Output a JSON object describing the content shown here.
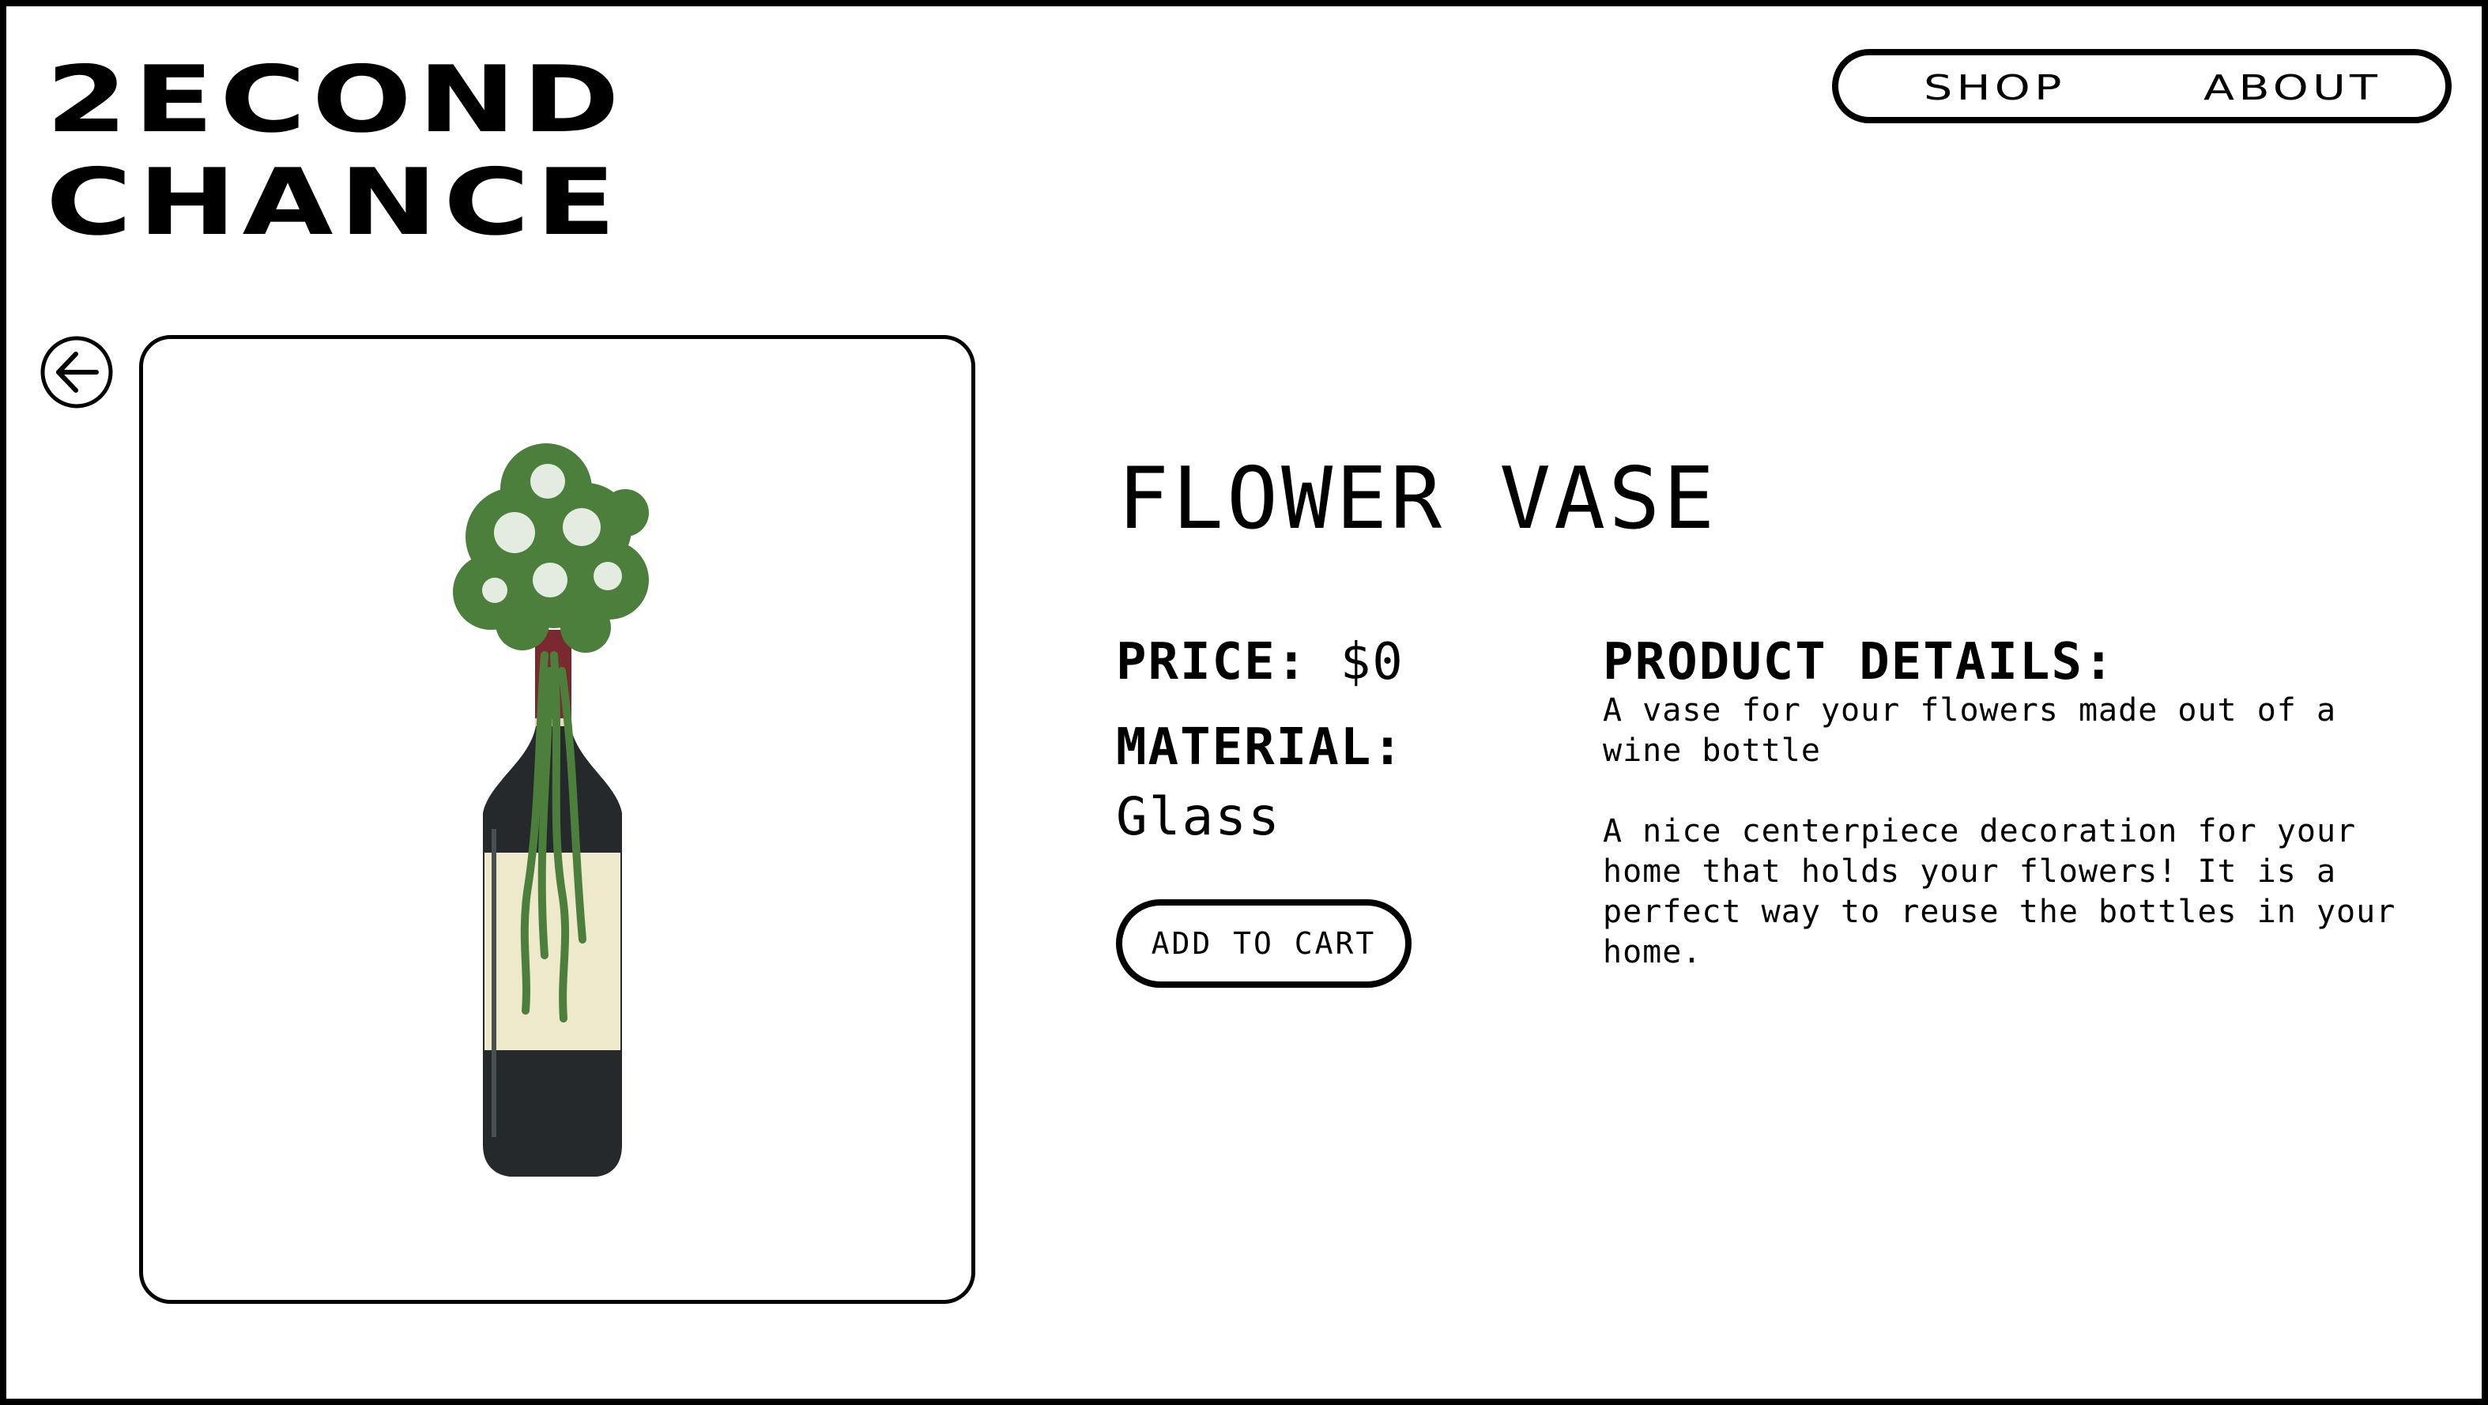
{
  "header": {
    "logo_line1": "2ECOND",
    "logo_line2": "CHANCE"
  },
  "nav": {
    "shop_label": "SHOP",
    "about_label": "ABOUT"
  },
  "back_icon": "arrow-left-circle-icon",
  "product": {
    "image_name": "wine-bottle-flower-vase",
    "title": "FLOWER VASE",
    "price_label": "PRICE:",
    "price_value": "$0",
    "material_label": "MATERIAL:",
    "material_value": "Glass",
    "add_to_cart_label": "ADD TO CART",
    "details_label": "PRODUCT DETAILS:",
    "details_paragraph_1": "A vase for your flowers made out of a wine bottle",
    "details_paragraph_2": "A nice centerpiece decoration for your home that holds your flowers! It is a perfect way to reuse the bottles in your home."
  },
  "colors": {
    "text": "#000000",
    "background": "#ffffff",
    "foliage": "#4d7f3c",
    "bottle_glass": "#26292b",
    "bottle_label": "#efe9cc",
    "bottle_capsule": "#7a2a2e"
  }
}
